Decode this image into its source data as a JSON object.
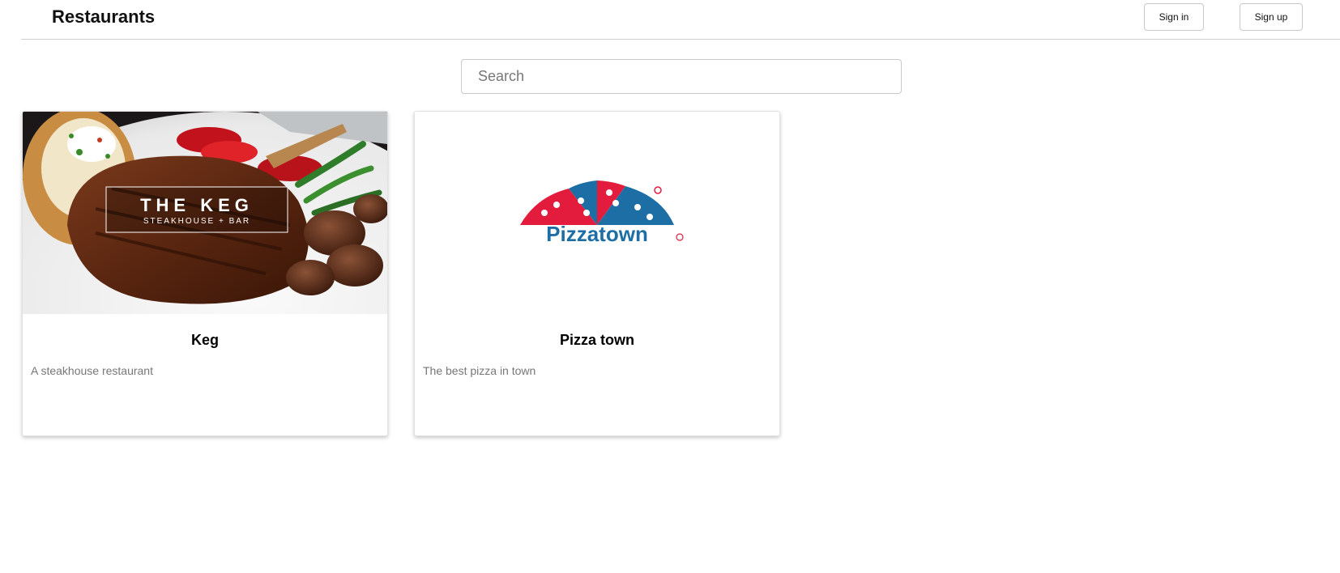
{
  "header": {
    "title": "Restaurants",
    "sign_in_label": "Sign in",
    "sign_up_label": "Sign up"
  },
  "search": {
    "placeholder": "Search",
    "value": ""
  },
  "restaurants": [
    {
      "name": "Keg",
      "description": "A steakhouse restaurant",
      "image_text": {
        "line1": "THE KEG",
        "line2": "STEAKHOUSE + BAR"
      }
    },
    {
      "name": "Pizza town",
      "description": "The best pizza in town",
      "image_text": {
        "logo": "Pizzatown"
      }
    }
  ],
  "colors": {
    "pizzatown_red": "#e31c3d",
    "pizzatown_blue": "#1d6ea5",
    "border": "#c9c9c9",
    "muted_text": "#777777"
  }
}
